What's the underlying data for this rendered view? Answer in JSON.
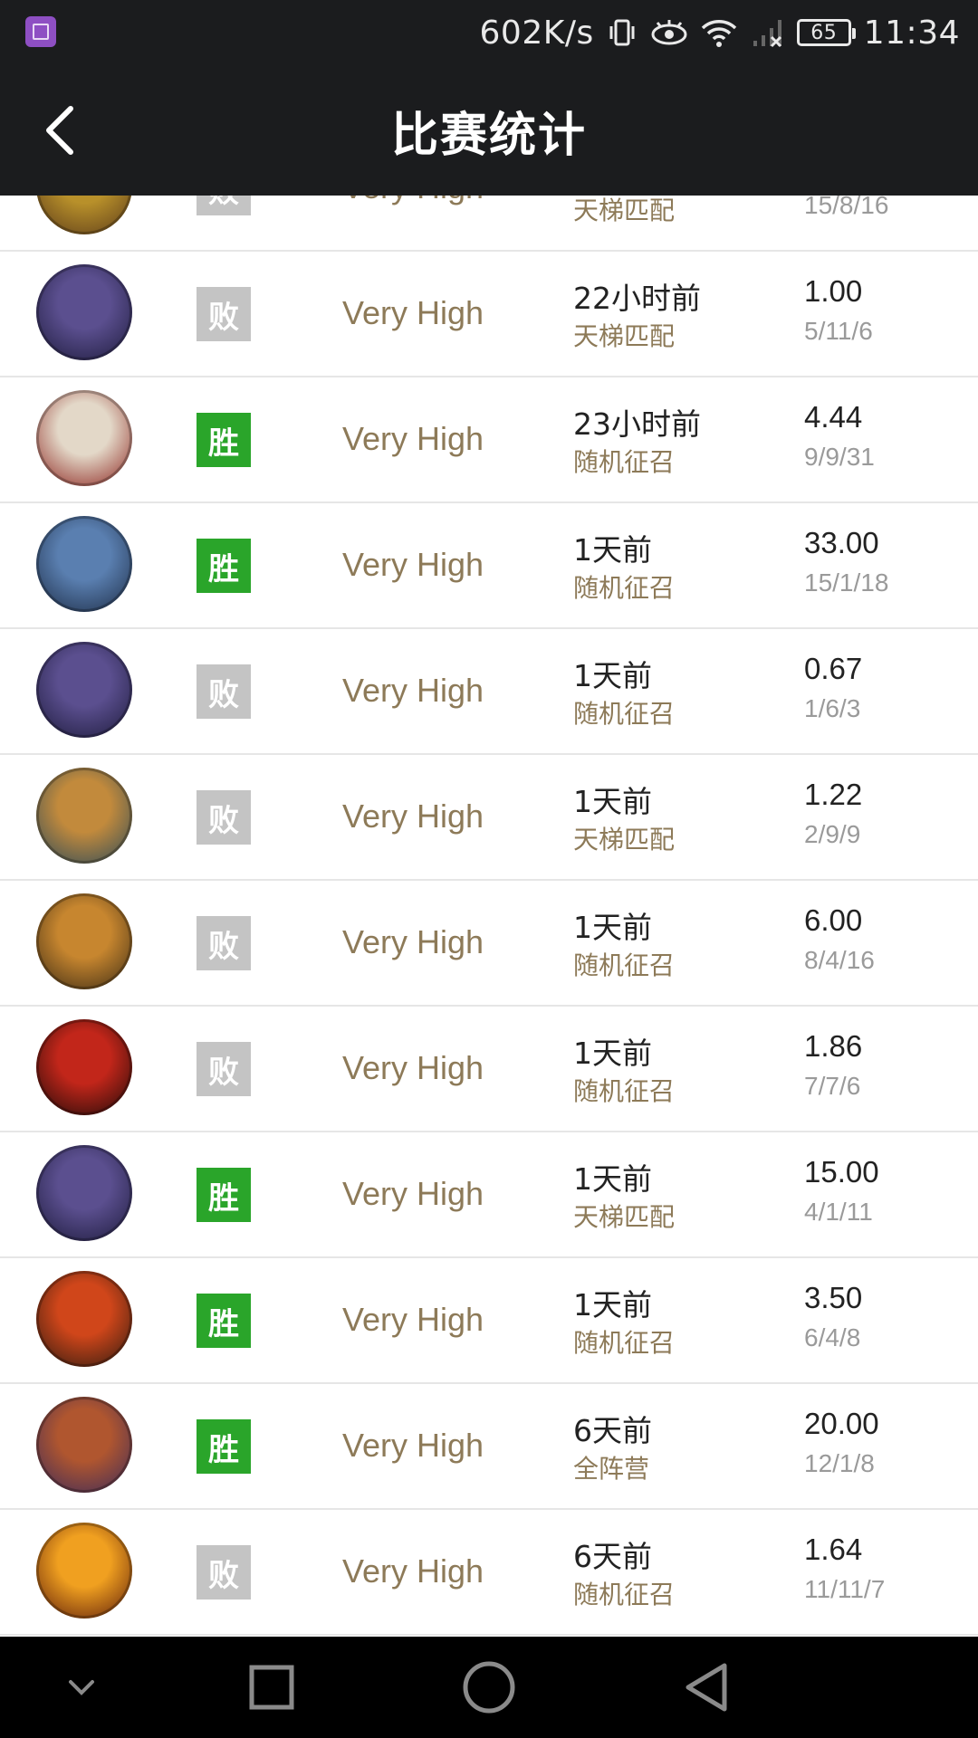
{
  "status_bar": {
    "net_speed": "602K/s",
    "battery": "65",
    "time": "11:34",
    "icons": [
      "gallery-app-icon",
      "vibrate-icon",
      "eye-icon",
      "wifi-icon",
      "signal-icon",
      "battery-icon"
    ]
  },
  "header": {
    "title": "比赛统计",
    "back_icon": "chevron-left-icon"
  },
  "colors": {
    "bar_bg": "#1b1c1e",
    "win": "#2aa52a",
    "loss": "#c4c4c4",
    "skill_text": "#8d7a58"
  },
  "matches": [
    {
      "result": "败",
      "outcome": "loss",
      "skill": "Very High",
      "time": "",
      "mode": "天梯匹配",
      "kda": "",
      "kills": "15/8/16",
      "hero_colors": [
        "#b8902a",
        "#5a3a1a"
      ]
    },
    {
      "result": "败",
      "outcome": "loss",
      "skill": "Very High",
      "time": "22小时前",
      "mode": "天梯匹配",
      "kda": "1.00",
      "kills": "5/11/6",
      "hero_colors": [
        "#5b4f8f",
        "#1c1a3a"
      ]
    },
    {
      "result": "胜",
      "outcome": "win",
      "skill": "Very High",
      "time": "23小时前",
      "mode": "随机征召",
      "kda": "4.44",
      "kills": "9/9/31",
      "hero_colors": [
        "#e3d8c8",
        "#8a1f1a"
      ]
    },
    {
      "result": "胜",
      "outcome": "win",
      "skill": "Very High",
      "time": "1天前",
      "mode": "随机征召",
      "kda": "33.00",
      "kills": "15/1/18",
      "hero_colors": [
        "#5a7fb0",
        "#1c2b44"
      ]
    },
    {
      "result": "败",
      "outcome": "loss",
      "skill": "Very High",
      "time": "1天前",
      "mode": "随机征召",
      "kda": "0.67",
      "kills": "1/6/3",
      "hero_colors": [
        "#5b4f8f",
        "#1c1a3a"
      ]
    },
    {
      "result": "败",
      "outcome": "loss",
      "skill": "Very High",
      "time": "1天前",
      "mode": "天梯匹配",
      "kda": "1.22",
      "kills": "2/9/9",
      "hero_colors": [
        "#c28a3c",
        "#2a4a5a"
      ]
    },
    {
      "result": "败",
      "outcome": "loss",
      "skill": "Very High",
      "time": "1天前",
      "mode": "随机征召",
      "kda": "6.00",
      "kills": "8/4/16",
      "hero_colors": [
        "#c7862f",
        "#3a2a14"
      ]
    },
    {
      "result": "败",
      "outcome": "loss",
      "skill": "Very High",
      "time": "1天前",
      "mode": "随机征召",
      "kda": "1.86",
      "kills": "7/7/6",
      "hero_colors": [
        "#c2261a",
        "#1a0a08"
      ]
    },
    {
      "result": "胜",
      "outcome": "win",
      "skill": "Very High",
      "time": "1天前",
      "mode": "天梯匹配",
      "kda": "15.00",
      "kills": "4/1/11",
      "hero_colors": [
        "#5b4f8f",
        "#1c1a3a"
      ]
    },
    {
      "result": "胜",
      "outcome": "win",
      "skill": "Very High",
      "time": "1天前",
      "mode": "随机征召",
      "kda": "3.50",
      "kills": "6/4/8",
      "hero_colors": [
        "#d0461a",
        "#2a1a10"
      ]
    },
    {
      "result": "胜",
      "outcome": "win",
      "skill": "Very High",
      "time": "6天前",
      "mode": "全阵营",
      "kda": "20.00",
      "kills": "12/1/8",
      "hero_colors": [
        "#b0562f",
        "#3a2a5a"
      ]
    },
    {
      "result": "败",
      "outcome": "loss",
      "skill": "Very High",
      "time": "6天前",
      "mode": "随机征召",
      "kda": "1.64",
      "kills": "11/11/7",
      "hero_colors": [
        "#f0a020",
        "#5a1a0a"
      ]
    }
  ],
  "nav_bar": {
    "icons": [
      "chevron-down-icon",
      "recent-apps-icon",
      "home-icon",
      "back-icon"
    ]
  }
}
